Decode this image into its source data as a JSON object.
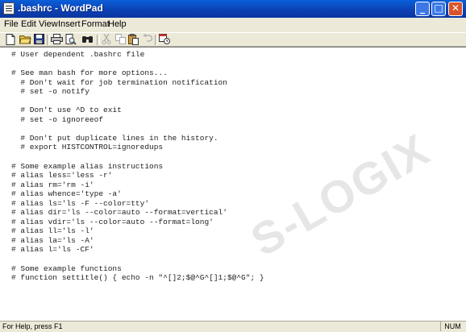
{
  "window": {
    "title": ".bashrc - WordPad",
    "icon": "wordpad-icon"
  },
  "title_buttons": {
    "minimize": "_",
    "maximize": "□",
    "close": "✕"
  },
  "menu": {
    "file": "File",
    "edit": "Edit",
    "view": "View",
    "insert": "Insert",
    "format": "Format",
    "help": "Help"
  },
  "toolbar": {
    "new": "new-document-icon",
    "open": "open-folder-icon",
    "save": "save-icon",
    "print": "print-icon",
    "print_preview": "print-preview-icon",
    "find": "find-icon",
    "cut": "cut-icon",
    "copy": "copy-icon",
    "paste": "paste-icon",
    "undo": "undo-icon",
    "datetime": "date-time-icon"
  },
  "document": {
    "lines": [
      "# User dependent .bashrc file",
      "",
      "# See man bash for more options...",
      "  # Don't wait for job termination notification",
      "  # set -o notify",
      "",
      "  # Don't use ^D to exit",
      "  # set -o ignoreeof",
      "",
      "  # Don't put duplicate lines in the history.",
      "  # export HISTCONTROL=ignoredups",
      "",
      "# Some example alias instructions",
      "# alias less='less -r'",
      "# alias rm='rm -i'",
      "# alias whence='type -a'",
      "# alias ls='ls -F --color=tty'",
      "# alias dir='ls --color=auto --format=vertical'",
      "# alias vdir='ls --color=auto --format=long'",
      "# alias ll='ls -l'",
      "# alias la='ls -A'",
      "# alias l='ls -CF'",
      "",
      "# Some example functions",
      "# function settitle() { echo -n \"^[]2;$@^G^[]1;$@^G\"; }"
    ],
    "watermark": "S-LOGIX"
  },
  "status": {
    "help": "For Help, press F1",
    "num": "NUM"
  },
  "colors": {
    "title_bar": "#0c3fb3",
    "close_button": "#d9542c",
    "chrome": "#ece9d8",
    "document_bg": "#ffffff"
  }
}
